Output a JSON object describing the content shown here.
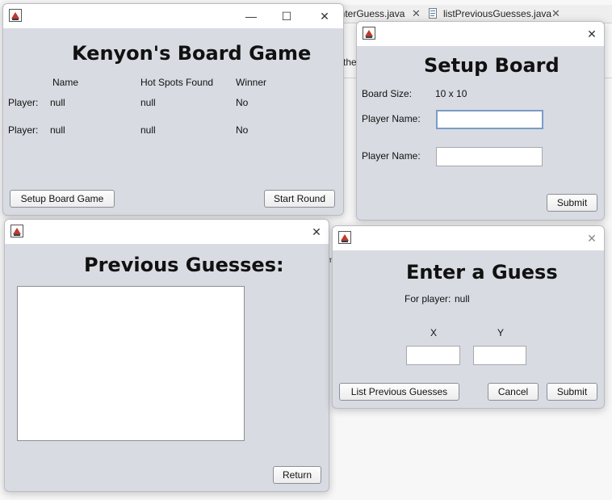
{
  "background": {
    "tabs": [
      "enterGuess.java",
      "listPreviousGuesses.java"
    ],
    "fragment_the": "the",
    "fragment_m": "m"
  },
  "main_window": {
    "title": "Kenyon's Board Game",
    "col_name": "Name",
    "col_hot_spots": "Hot Spots Found",
    "col_winner": "Winner",
    "rows": [
      {
        "label": "Player:",
        "name": "null",
        "hot_spots": "null",
        "winner": "No"
      },
      {
        "label": "Player:",
        "name": "null",
        "hot_spots": "null",
        "winner": "No"
      }
    ],
    "setup_button": "Setup Board Game",
    "start_button": "Start Round"
  },
  "setup_window": {
    "title": "Setup Board",
    "board_size_label": "Board Size:",
    "board_size_value": "10 x 10",
    "player_name_label_1": "Player Name:",
    "player_name_value_1": "",
    "player_name_label_2": "Player Name:",
    "player_name_value_2": "",
    "submit_button": "Submit"
  },
  "previous_window": {
    "title": "Previous Guesses:",
    "return_button": "Return"
  },
  "guess_window": {
    "title": "Enter a Guess",
    "for_player_label": "For player:",
    "for_player_value": "null",
    "x_label": "X",
    "y_label": "Y",
    "x_value": "",
    "y_value": "",
    "list_button": "List Previous Guesses",
    "cancel_button": "Cancel",
    "submit_button": "Submit"
  },
  "titlebar_glyphs": {
    "minimize": "—",
    "maximize": "☐",
    "close": "✕"
  }
}
